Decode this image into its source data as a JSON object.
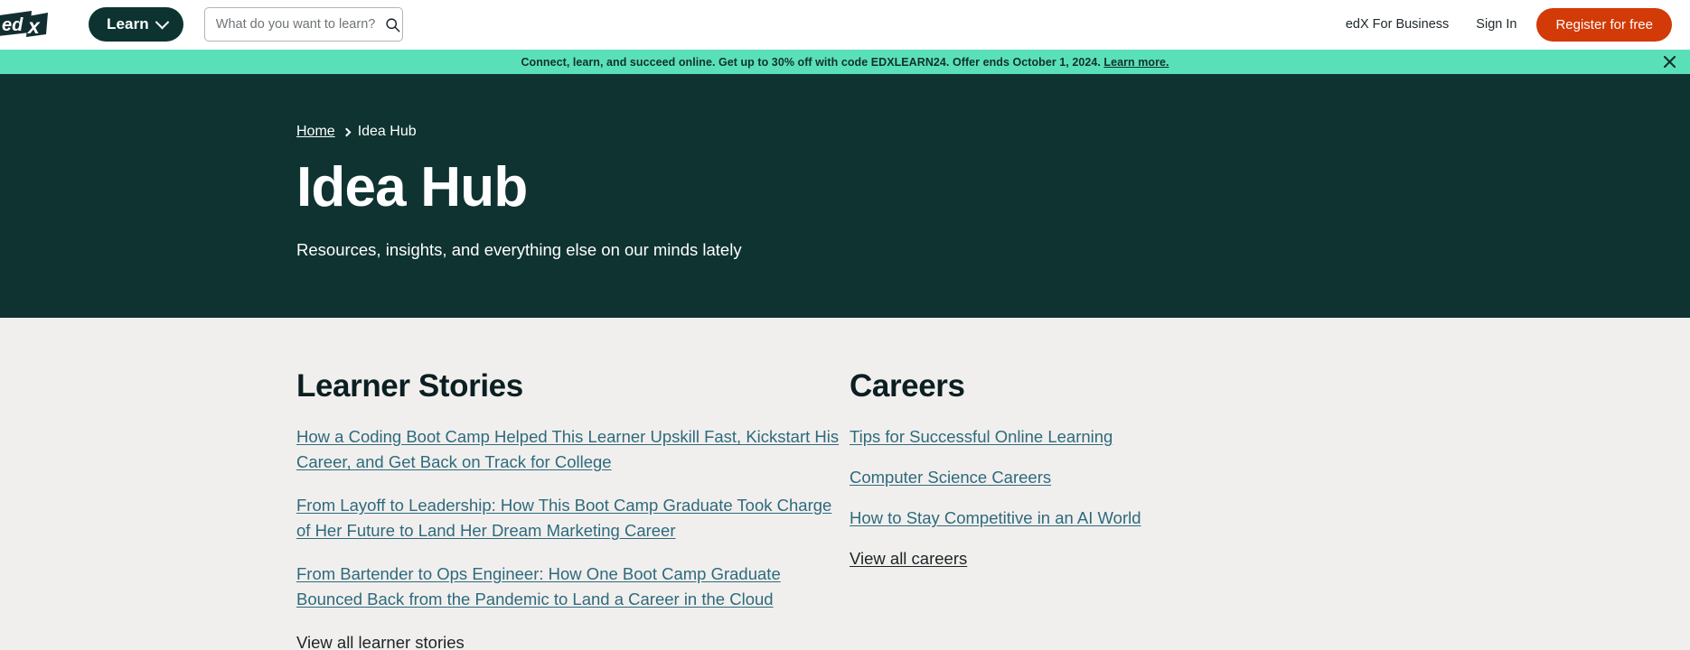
{
  "header": {
    "logo_alt": "edX",
    "learn_button": "Learn",
    "search": {
      "placeholder": "What do you want to learn?",
      "value": ""
    },
    "business_link": "edX For Business",
    "sign_in_link": "Sign In",
    "register_button": "Register for free"
  },
  "promo": {
    "text": "Connect, learn, and succeed online. Get up to 30% off with code EDXLEARN24. Offer ends October 1, 2024.",
    "link_text": "Learn more.",
    "background": "#5ae0b9",
    "close_label": "✕"
  },
  "hero": {
    "background": "#0e3331",
    "breadcrumb": {
      "home": "Home",
      "current": "Idea Hub"
    },
    "title": "Idea Hub",
    "subtitle": "Resources, insights, and everything else on our minds lately"
  },
  "main": {
    "background": "#f1efed",
    "link_color": "#2d6a7d",
    "sections": [
      {
        "title": "Learner Stories",
        "links": [
          "How a Coding Boot Camp Helped This Learner Upskill Fast, Kickstart His Career, and Get Back on Track for College",
          "From Layoff to Leadership: How This Boot Camp Graduate Took Charge of Her Future to Land Her Dream Marketing Career",
          "From Bartender to Ops Engineer: How One Boot Camp Graduate Bounced Back from the Pandemic to Land a Career in the Cloud"
        ],
        "view_all": "View all learner stories"
      },
      {
        "title": "Careers",
        "links": [
          "Tips for Successful Online Learning",
          "Computer Science Careers",
          "How to Stay Competitive in an AI World"
        ],
        "view_all": "View all careers"
      }
    ]
  }
}
